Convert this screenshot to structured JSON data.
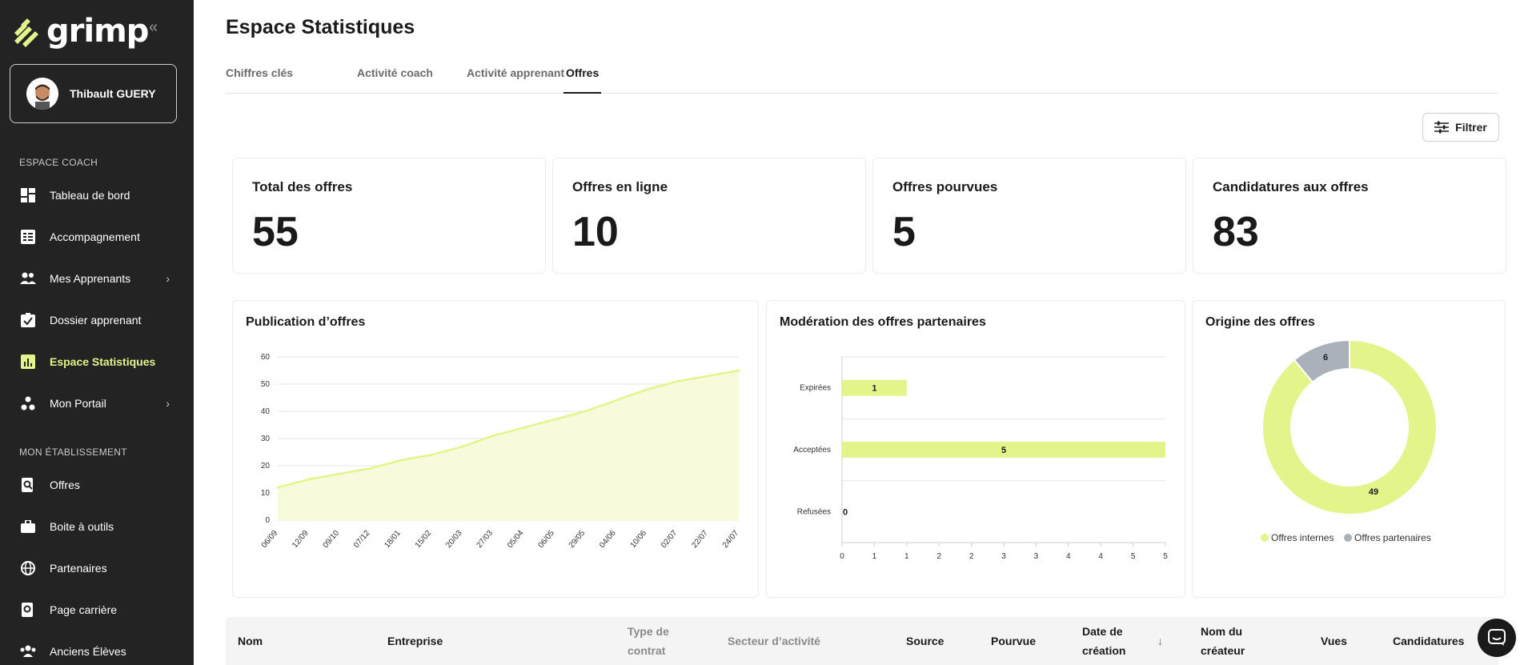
{
  "sidebar": {
    "brand": "grimp",
    "user": {
      "name": "Thibault GUERY"
    },
    "section_coach": "ESPACE COACH",
    "section_etab": "MON ÉTABLISSEMENT",
    "coach_items": [
      {
        "label": "Tableau de bord",
        "icon": "dashboard-icon"
      },
      {
        "label": "Accompagnement",
        "icon": "checklist-icon"
      },
      {
        "label": "Mes Apprenants",
        "icon": "people-icon",
        "has_chevron": true
      },
      {
        "label": "Dossier apprenant",
        "icon": "folder-check-icon"
      },
      {
        "label": "Espace Statistiques",
        "icon": "stats-icon",
        "active": true
      },
      {
        "label": "Mon Portail",
        "icon": "portal-icon",
        "has_chevron": true
      }
    ],
    "etab_items": [
      {
        "label": "Offres",
        "icon": "offer-search-icon"
      },
      {
        "label": "Boite à outils",
        "icon": "toolbox-icon"
      },
      {
        "label": "Partenaires",
        "icon": "globe-icon"
      },
      {
        "label": "Page carrière",
        "icon": "career-page-icon"
      },
      {
        "label": "Anciens Élèves",
        "icon": "alumni-icon"
      }
    ]
  },
  "page": {
    "title": "Espace Statistiques",
    "tabs": [
      "Chiffres clés",
      "Activité coach",
      "Activité apprenant",
      "Offres"
    ],
    "active_tab": "Offres",
    "filter_label": "Filtrer"
  },
  "kpis": [
    {
      "label": "Total des offres",
      "value": "55"
    },
    {
      "label": "Offres en ligne",
      "value": "10"
    },
    {
      "label": "Offres pourvues",
      "value": "5"
    },
    {
      "label": "Candidatures aux offres",
      "value": "83"
    }
  ],
  "colors": {
    "accent": "#e3f58a",
    "accent_light": "#f7fbdc",
    "grey_slice": "#aab1bb",
    "sidebar_bg": "#232323"
  },
  "chart_data": [
    {
      "type": "area",
      "title": "Publication d’offres",
      "x": [
        "06/09",
        "12/09",
        "09/10",
        "07/12",
        "18/01",
        "15/02",
        "20/03",
        "27/03",
        "05/04",
        "06/05",
        "29/05",
        "04/06",
        "10/06",
        "02/07",
        "22/07",
        "24/07"
      ],
      "values": [
        12,
        15,
        17,
        19,
        22,
        24,
        27,
        31,
        34,
        37,
        40,
        44,
        48,
        51,
        53,
        55
      ],
      "ylim": [
        0,
        60
      ],
      "yticks": [
        0,
        10,
        20,
        30,
        40,
        50,
        60
      ],
      "grid": true
    },
    {
      "type": "bar",
      "orientation": "horizontal",
      "title": "Modération des offres partenaires",
      "categories": [
        "Expirées",
        "Acceptées",
        "Refusées"
      ],
      "values": [
        1,
        5,
        0
      ],
      "xticks": [
        "0",
        "1",
        "1",
        "2",
        "2",
        "3",
        "3",
        "4",
        "4",
        "5",
        "5"
      ],
      "xlim": [
        0,
        5
      ]
    },
    {
      "type": "pie",
      "donut": true,
      "title": "Origine des offres",
      "labels": [
        "Offres internes",
        "Offres partenaires"
      ],
      "values": [
        49,
        6
      ],
      "legend": "bottom"
    }
  ],
  "table": {
    "headers": [
      "Nom",
      "Entreprise",
      "Type de contrat",
      "Secteur d’activité",
      "Source",
      "Pourvue",
      "Date de création",
      "Nom du créateur",
      "Vues",
      "Candidatures"
    ]
  }
}
